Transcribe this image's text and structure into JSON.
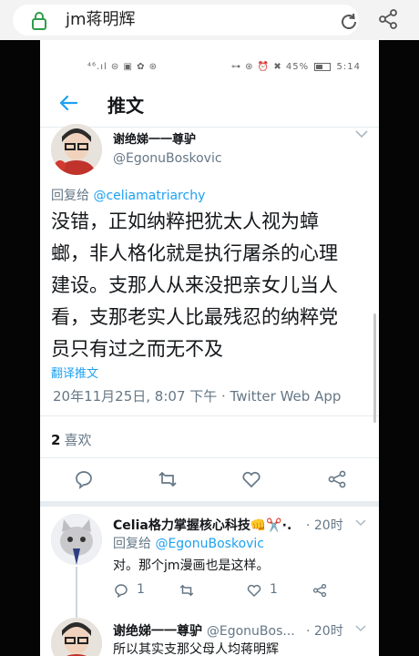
{
  "browser": {
    "url": "jm蒋明辉",
    "lock_icon": "lock-icon",
    "reload_icon": "reload-icon",
    "share_icon": "share-icon"
  },
  "status_bar": {
    "left": "⁴⁶.ıl ⊜ ▣ ✿ ⊛",
    "right_icons": "⊶ ⊛ ⏰ ✖",
    "battery": "45%",
    "time": "5:14"
  },
  "header": {
    "title": "推文"
  },
  "main_tweet": {
    "display_name": "谢绝娣一一尊驴",
    "handle": "@EgonuBoskovic",
    "reply_to_prefix": "回复给 ",
    "reply_to_handle": "@celiamatriarchy",
    "text_lines": [
      "没错，正如纳粹把犹太人视为蟑",
      "螂，非人格化就是执行屠杀的心理",
      "建设。支那人从来没把亲女儿当人",
      "看，支那老实人比最残忍的纳粹党",
      "员只有过之而无不及"
    ],
    "translate": "翻译推文",
    "timestamp": "20年11月25日, 8:07 下午 · Twitter Web App",
    "likes_count": "2",
    "likes_label": "喜欢"
  },
  "replies": [
    {
      "display_name": "Celia格力掌握核心科技👊✂️·.",
      "time": "· 20时",
      "reply_to_prefix": "回复给 ",
      "reply_to_handle": "@EgonuBoskovic",
      "text": "对。那个jm漫画也是这样。",
      "reply_count": "1",
      "like_count": "1"
    },
    {
      "display_name": "谢绝娣一一尊驴",
      "handle": "@EgonuBos...",
      "time": "· 20时",
      "text": "所以其实支那父母人均蒋明辉"
    }
  ],
  "colors": {
    "accent": "#1da1f2",
    "text": "#14171a",
    "secondary": "#657786",
    "border": "#e6ecf0"
  }
}
